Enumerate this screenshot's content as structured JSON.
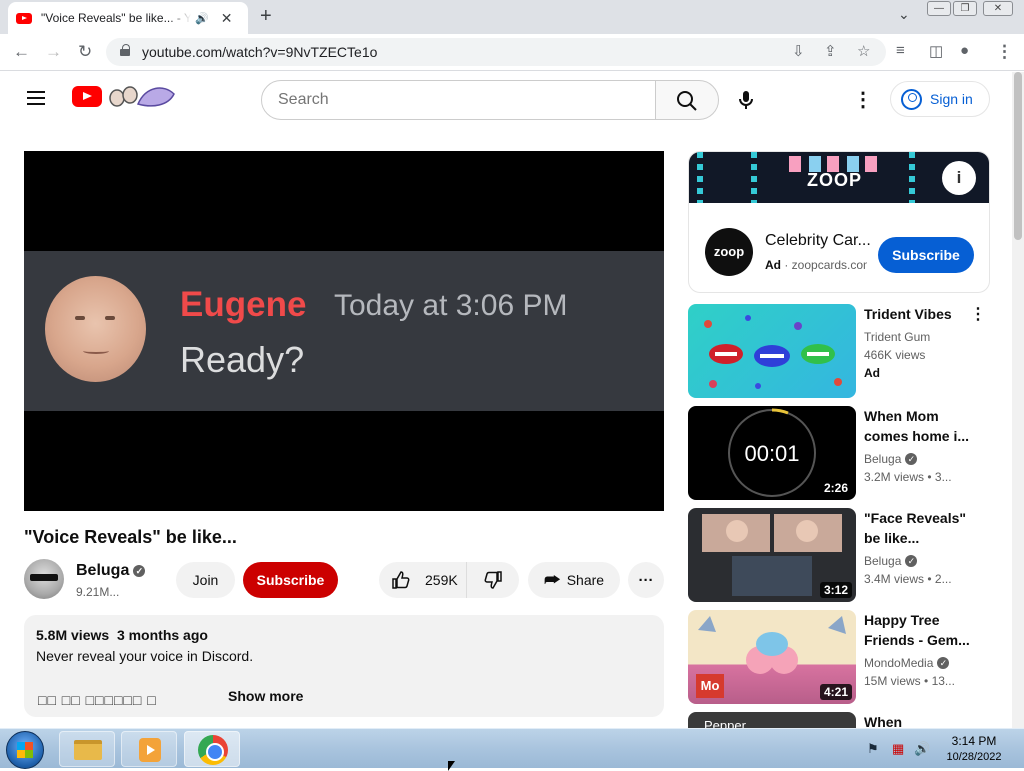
{
  "browser": {
    "tab_title": "\"Voice Reveals\" be like... - YouTube",
    "url": "youtube.com/watch?v=9NvTZECTe1o"
  },
  "header": {
    "search_placeholder": "Search",
    "sign_in": "Sign in"
  },
  "player": {
    "discord_name": "Eugene",
    "discord_time": "Today at 3:06 PM",
    "discord_message": "Ready?"
  },
  "video": {
    "title": "\"Voice Reveals\" be like...",
    "channel": "Beluga",
    "subscribers": "9.21M...",
    "join": "Join",
    "subscribe": "Subscribe",
    "likes": "259K",
    "share": "Share"
  },
  "description": {
    "views": "5.8M views",
    "date": "3 months ago",
    "text": "Never reveal your voice in Discord.",
    "garbled": "□□ □□ □□□□□□ □",
    "show_more": "Show more"
  },
  "ad": {
    "banner_text": "ZOOP",
    "logo_text": "zoop",
    "title": "Celebrity Car...",
    "label": "Ad",
    "domain": "zoopcards.com",
    "subscribe": "Subscribe",
    "info_icon": "info-icon"
  },
  "recommendations": [
    {
      "title1": "Trident Vibes",
      "title2": "",
      "channel": "Trident Gum",
      "views": "466K views",
      "ad_label": "Ad",
      "duration": ""
    },
    {
      "title1": "When Mom",
      "title2": "comes home i...",
      "channel": "Beluga",
      "views": "3.2M views",
      "age": "3...",
      "duration": "2:26",
      "timer": "00:01"
    },
    {
      "title1": "\"Face Reveals\"",
      "title2": "be like...",
      "channel": "Beluga",
      "views": "3.4M views",
      "age": "2...",
      "duration": "3:12"
    },
    {
      "title1": "Happy Tree",
      "title2": "Friends - Gem...",
      "channel": "MondoMedia",
      "views": "15M views",
      "age": "13...",
      "duration": "4:21",
      "badge": "Mo"
    },
    {
      "title1": "When",
      "title2": "",
      "channel": "",
      "views": "",
      "duration": "",
      "thumb_text": "Pepper"
    }
  ],
  "taskbar": {
    "time": "3:14 PM",
    "date": "10/28/2022"
  },
  "colors": {
    "youtube_red": "#ff0000",
    "subscribe_red": "#cc0000",
    "link_blue": "#065fd4",
    "discord_name": "#f04a4a"
  }
}
